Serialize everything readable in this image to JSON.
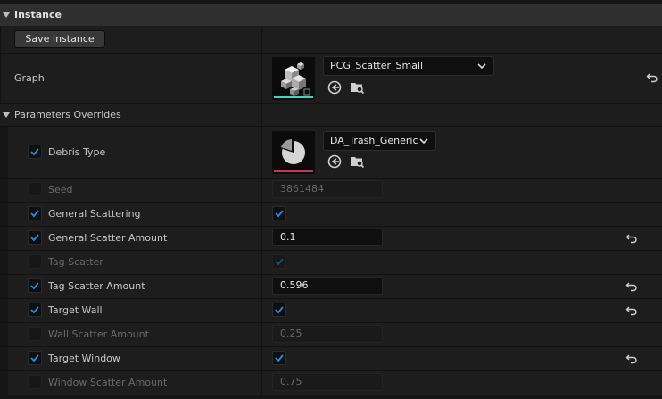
{
  "instance": {
    "section_title": "Instance",
    "save_button": "Save Instance",
    "graph_label": "Graph",
    "graph_value": "PCG_Scatter_Small",
    "graph_thumb_bar_color": "#3ad6c0"
  },
  "overrides": {
    "section_title": "Parameters Overrides",
    "debris": {
      "label": "Debris Type",
      "value": "DA_Trash_Generic",
      "checked": true,
      "thumb_bar_color": "#c8325a"
    },
    "seed": {
      "label": "Seed",
      "value": "3861484",
      "checked": false
    },
    "general_scattering": {
      "label": "General Scattering",
      "checked": true,
      "value_checked": true
    },
    "general_scatter_amount": {
      "label": "General Scatter Amount",
      "value": "0.1",
      "checked": true
    },
    "tag_scatter": {
      "label": "Tag Scatter",
      "checked": false,
      "value_checked": true
    },
    "tag_scatter_amount": {
      "label": "Tag Scatter Amount",
      "value": "0.596",
      "checked": true
    },
    "target_wall": {
      "label": "Target Wall",
      "checked": true,
      "value_checked": true
    },
    "wall_scatter_amount": {
      "label": "Wall Scatter Amount",
      "value": "0.25",
      "checked": false
    },
    "target_window": {
      "label": "Target Window",
      "checked": true,
      "value_checked": true
    },
    "window_scatter_amount": {
      "label": "Window Scatter Amount",
      "value": "0.75",
      "checked": false
    }
  },
  "icons": {
    "section_arrow": "triangle-down-icon",
    "browse": "use-selected-asset-icon",
    "find": "browse-to-asset-icon",
    "reset": "reset-to-default-icon",
    "dropdown": "chevron-down-icon",
    "check": "checkmark-icon"
  },
  "colors": {
    "accent": "#1c8fe8",
    "panel": "#1d1d1d",
    "header": "#2f2f2f"
  }
}
